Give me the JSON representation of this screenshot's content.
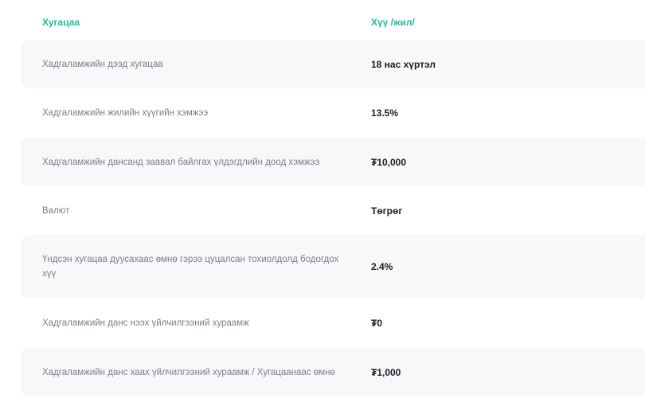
{
  "header": {
    "col_term": "Хугацаа",
    "col_rate": "Хүү /жил/"
  },
  "rows": [
    {
      "label": "Хадгаламжийн дээд хугацаа",
      "value": "18 нас хүртэл"
    },
    {
      "label": "Хадгаламжийн жилийн хүүгийн хэмжээ",
      "value": "13.5%"
    },
    {
      "label": "Хадгаламжийн дансанд заавал байлгах үлдэгдлийн доод хэмжээ",
      "value": "₮10,000"
    },
    {
      "label": "Валют",
      "value": "Төгрөг"
    },
    {
      "label": "Үндсэн хугацаа дуусахаас өмнө гэрээ цуцалсан тохиолдолд бодогдох хүү",
      "value": "2.4%"
    },
    {
      "label": "Хадгаламжийн данс нээх үйлчилгээний хураамж",
      "value": "₮0"
    },
    {
      "label": "Хадгаламжийн данс хаах үйлчилгээний хураамж / Хугацаанаас өмнө",
      "value": "₮1,000"
    }
  ],
  "colors": {
    "accent": "#1fbf9a",
    "row_shade": "#f7f8fa",
    "label_text": "#7a7f87",
    "value_text": "#1b1e22"
  }
}
